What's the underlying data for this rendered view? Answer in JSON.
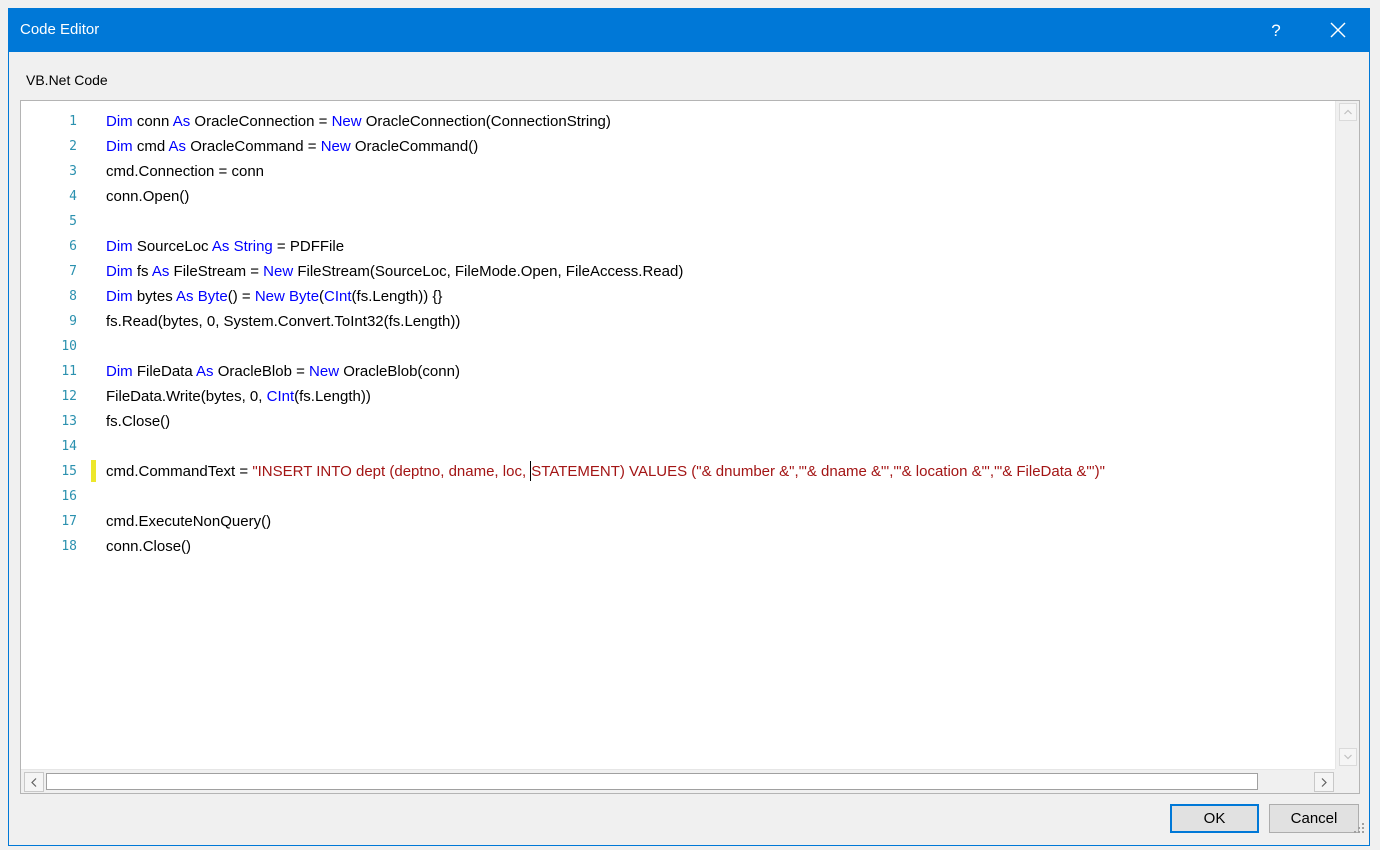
{
  "window": {
    "title": "Code Editor",
    "help_label": "?",
    "titlebar_color": "#0078d7"
  },
  "editor": {
    "label": "VB.Net Code",
    "colors": {
      "keyword": "#0000ff",
      "string": "#a31515",
      "line_number": "#2b91af",
      "modified_marker": "#ede72b"
    },
    "caret": {
      "line": 15,
      "after_text": "cmd.CommandText = \"INSERT INTO dept (deptno, dname, loc, "
    },
    "lines": [
      {
        "num": "1",
        "tokens": [
          {
            "t": "kw",
            "v": "Dim"
          },
          {
            "t": "pl",
            "v": " conn "
          },
          {
            "t": "kw",
            "v": "As"
          },
          {
            "t": "pl",
            "v": " OracleConnection = "
          },
          {
            "t": "kw",
            "v": "New"
          },
          {
            "t": "pl",
            "v": " OracleConnection(ConnectionString)"
          }
        ]
      },
      {
        "num": "2",
        "tokens": [
          {
            "t": "kw",
            "v": "Dim"
          },
          {
            "t": "pl",
            "v": " cmd "
          },
          {
            "t": "kw",
            "v": "As"
          },
          {
            "t": "pl",
            "v": " OracleCommand = "
          },
          {
            "t": "kw",
            "v": "New"
          },
          {
            "t": "pl",
            "v": " OracleCommand()"
          }
        ]
      },
      {
        "num": "3",
        "tokens": [
          {
            "t": "pl",
            "v": "cmd.Connection = conn"
          }
        ]
      },
      {
        "num": "4",
        "tokens": [
          {
            "t": "pl",
            "v": "conn.Open()"
          }
        ]
      },
      {
        "num": "5",
        "tokens": []
      },
      {
        "num": "6",
        "tokens": [
          {
            "t": "kw",
            "v": "Dim"
          },
          {
            "t": "pl",
            "v": " SourceLoc "
          },
          {
            "t": "kw",
            "v": "As"
          },
          {
            "t": "pl",
            "v": " "
          },
          {
            "t": "kw",
            "v": "String"
          },
          {
            "t": "pl",
            "v": " = PDFFile"
          }
        ]
      },
      {
        "num": "7",
        "tokens": [
          {
            "t": "kw",
            "v": "Dim"
          },
          {
            "t": "pl",
            "v": " fs "
          },
          {
            "t": "kw",
            "v": "As"
          },
          {
            "t": "pl",
            "v": " FileStream = "
          },
          {
            "t": "kw",
            "v": "New"
          },
          {
            "t": "pl",
            "v": " FileStream(SourceLoc, FileMode.Open, FileAccess.Read)"
          }
        ]
      },
      {
        "num": "8",
        "tokens": [
          {
            "t": "kw",
            "v": "Dim"
          },
          {
            "t": "pl",
            "v": " bytes "
          },
          {
            "t": "kw",
            "v": "As"
          },
          {
            "t": "pl",
            "v": " "
          },
          {
            "t": "kw",
            "v": "Byte"
          },
          {
            "t": "pl",
            "v": "() = "
          },
          {
            "t": "kw",
            "v": "New"
          },
          {
            "t": "pl",
            "v": " "
          },
          {
            "t": "kw",
            "v": "Byte"
          },
          {
            "t": "pl",
            "v": "("
          },
          {
            "t": "kw",
            "v": "CInt"
          },
          {
            "t": "pl",
            "v": "(fs.Length)) {}"
          }
        ]
      },
      {
        "num": "9",
        "tokens": [
          {
            "t": "pl",
            "v": "fs.Read(bytes, 0, System.Convert.ToInt32(fs.Length))"
          }
        ]
      },
      {
        "num": "10",
        "tokens": []
      },
      {
        "num": "11",
        "tokens": [
          {
            "t": "kw",
            "v": "Dim"
          },
          {
            "t": "pl",
            "v": " FileData "
          },
          {
            "t": "kw",
            "v": "As"
          },
          {
            "t": "pl",
            "v": " OracleBlob = "
          },
          {
            "t": "kw",
            "v": "New"
          },
          {
            "t": "pl",
            "v": " OracleBlob(conn)"
          }
        ]
      },
      {
        "num": "12",
        "tokens": [
          {
            "t": "pl",
            "v": "FileData.Write(bytes, 0, "
          },
          {
            "t": "kw",
            "v": "CInt"
          },
          {
            "t": "pl",
            "v": "(fs.Length))"
          }
        ]
      },
      {
        "num": "13",
        "tokens": [
          {
            "t": "pl",
            "v": "fs.Close()"
          }
        ]
      },
      {
        "num": "14",
        "tokens": []
      },
      {
        "num": "15",
        "modified": true,
        "tokens": [
          {
            "t": "pl",
            "v": "cmd.CommandText = "
          },
          {
            "t": "str",
            "v": "\"INSERT INTO dept (deptno, dname, loc, "
          },
          {
            "t": "caret",
            "v": ""
          },
          {
            "t": "str",
            "v": "STATEMENT) VALUES (\"& dnumber &\",'\"& dname &\"','\"& location &\"','\"& FileData &\"')\""
          }
        ]
      },
      {
        "num": "16",
        "tokens": []
      },
      {
        "num": "17",
        "tokens": [
          {
            "t": "pl",
            "v": "cmd.ExecuteNonQuery()"
          }
        ]
      },
      {
        "num": "18",
        "tokens": [
          {
            "t": "pl",
            "v": "conn.Close()"
          }
        ]
      }
    ]
  },
  "buttons": {
    "ok_label": "OK",
    "cancel_label": "Cancel"
  },
  "icons": {
    "close": "close-icon",
    "scroll_up": "chevron-up-icon",
    "scroll_down": "chevron-down-icon",
    "scroll_left": "chevron-left-icon",
    "scroll_right": "chevron-right-icon",
    "resize_grip": "resize-grip-icon"
  }
}
